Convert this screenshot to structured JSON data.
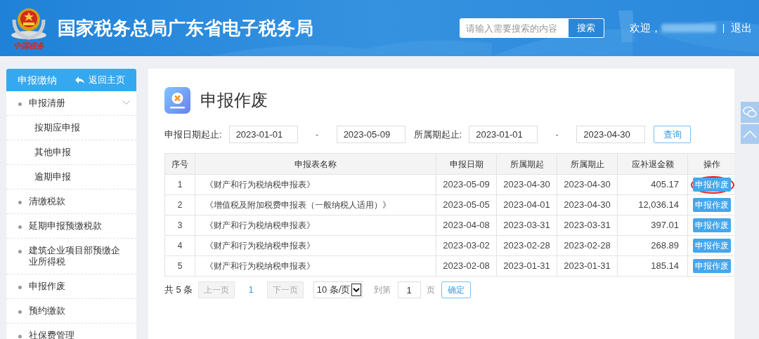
{
  "header": {
    "logo_caption": "中国税务",
    "title": "国家税务总局广东省电子税务局",
    "search": {
      "placeholder": "请输入需要搜索的内容",
      "button": "搜索"
    },
    "welcome": "欢迎，",
    "logout": "退出"
  },
  "sidebar": {
    "title": "申报缴纳",
    "back": "返回主页",
    "items": [
      {
        "label": "申报清册",
        "expanded": true,
        "children": [
          {
            "label": "按期应申报"
          },
          {
            "label": "其他申报"
          },
          {
            "label": "逾期申报"
          }
        ]
      },
      {
        "label": "清缴税款"
      },
      {
        "label": "延期申报预缴税款"
      },
      {
        "label": "建筑企业项目部预缴企业所得税"
      },
      {
        "label": "申报作废"
      },
      {
        "label": "预约缴款"
      },
      {
        "label": "社保费管理"
      }
    ]
  },
  "page": {
    "title": "申报作废",
    "filters": [
      {
        "label": "申报日期起止:",
        "from": "2023-01-01",
        "to": "2023-05-09"
      },
      {
        "label": "所属期起止:",
        "from": "2023-01-01",
        "to": "2023-04-30"
      }
    ],
    "separator": "-",
    "query_button": "查询",
    "table": {
      "columns": [
        "序号",
        "申报表名称",
        "申报日期",
        "所属期起",
        "所属期止",
        "应补退金额",
        "操作"
      ],
      "rows": [
        {
          "cells": [
            "1",
            "《财产和行为税纳税申报表》",
            "2023-05-09",
            "2023-04-30",
            "2023-04-30",
            "405.17"
          ],
          "action": "申报作废",
          "circled": true
        },
        {
          "cells": [
            "2",
            "《增值税及附加税费申报表（一般纳税人适用）》",
            "2023-05-05",
            "2023-04-01",
            "2023-04-30",
            "12,036.14"
          ],
          "action": "申报作废",
          "circled": false
        },
        {
          "cells": [
            "3",
            "《财产和行为税纳税申报表》",
            "2023-04-08",
            "2023-03-31",
            "2023-03-31",
            "397.01"
          ],
          "action": "申报作废",
          "circled": false
        },
        {
          "cells": [
            "4",
            "《财产和行为税纳税申报表》",
            "2023-03-02",
            "2023-02-28",
            "2023-02-28",
            "268.89"
          ],
          "action": "申报作废",
          "circled": false
        },
        {
          "cells": [
            "5",
            "《财产和行为税纳税申报表》",
            "2023-02-08",
            "2023-01-31",
            "2023-01-31",
            "185.14"
          ],
          "action": "申报作废",
          "circled": false
        }
      ]
    },
    "pagination": {
      "total": "共 5 条",
      "prev": "上一页",
      "current": "1",
      "next": "下一页",
      "page_size": "10 条/页",
      "goto_label": "到第",
      "goto_value": "1",
      "goto_unit": "页",
      "confirm": "确定"
    }
  }
}
